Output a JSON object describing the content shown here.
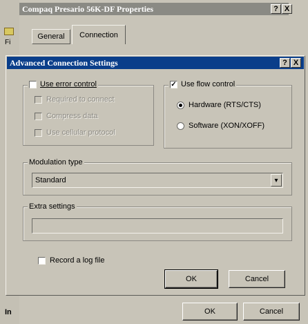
{
  "back_window": {
    "title": "Compaq Presario 56K-DF Properties",
    "help_btn": "?",
    "close_btn": "X",
    "tabs": [
      {
        "label": "General"
      },
      {
        "label": "Connection"
      }
    ],
    "left_fragment_1": "Fi",
    "left_fragment_2": "In",
    "ok_label": "OK",
    "cancel_label": "Cancel"
  },
  "dialog": {
    "title": "Advanced Connection Settings",
    "help_btn": "?",
    "close_btn": "X",
    "error_control": {
      "label": "Use error control",
      "checked": false,
      "options": [
        {
          "label": "Required to connect",
          "checked": false
        },
        {
          "label": "Compress data",
          "checked": false
        },
        {
          "label": "Use cellular protocol",
          "checked": false
        }
      ]
    },
    "flow_control": {
      "label": "Use flow control",
      "checked": true,
      "check_glyph": "✓",
      "options": [
        {
          "label": "Hardware (RTS/CTS)",
          "selected": true
        },
        {
          "label": "Software (XON/XOFF)",
          "selected": false
        }
      ]
    },
    "modulation": {
      "label": "Modulation type",
      "value": "Standard",
      "dropdown_glyph": "▾"
    },
    "extra_settings": {
      "label": "Extra settings",
      "value": ""
    },
    "log_file": {
      "label": "Record a log file",
      "checked": false
    },
    "ok_label": "OK",
    "cancel_label": "Cancel"
  }
}
